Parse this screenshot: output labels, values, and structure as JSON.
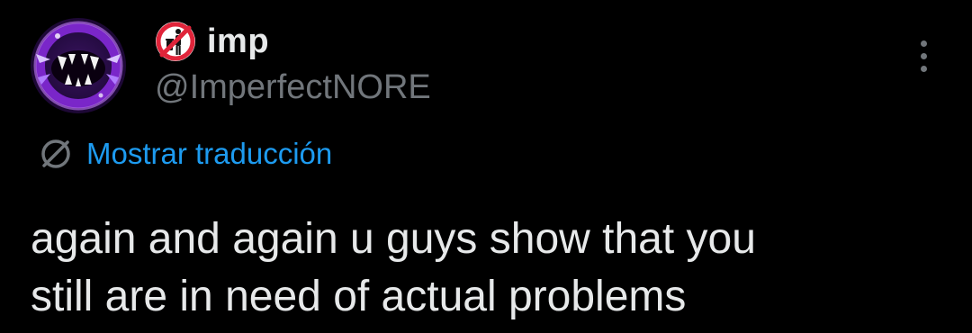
{
  "tweet": {
    "author": {
      "display_name": "imp",
      "handle": "@ImperfectNORE",
      "name_emoji_icon": "no-littering-icon",
      "avatar_icon": "purple-monster-mouth-avatar"
    },
    "more_icon": "more-vertical-icon",
    "translate": {
      "icon": "globe-icon",
      "label": "Mostrar traducción"
    },
    "text_lines": [
      "again and again u guys show that you",
      "still are in need of actual problems"
    ]
  },
  "colors": {
    "background": "#000000",
    "primary_text": "#e7e9ea",
    "secondary_text": "#71767b",
    "accent": "#1d9bf0",
    "emoji_red": "#e0243a",
    "avatar_purple": "#8a2be2"
  }
}
